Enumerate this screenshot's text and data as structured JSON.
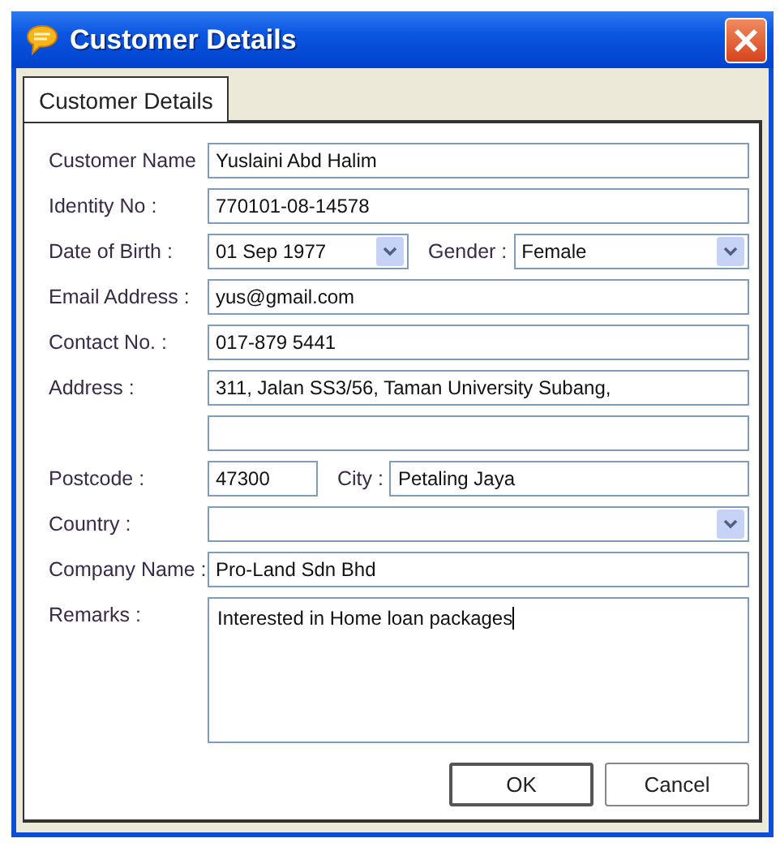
{
  "window": {
    "title": "Customer Details"
  },
  "tabs": [
    {
      "label": "Customer Details",
      "selected": true
    }
  ],
  "rows": [
    {
      "kind": "single",
      "label": "Customer Name",
      "inputs": [
        {
          "kind": "text",
          "value": "Yuslaini Abd Halim"
        }
      ]
    },
    {
      "kind": "single",
      "label": "Identity No :",
      "inputs": [
        {
          "kind": "text",
          "value": "770101-08-14578"
        }
      ]
    },
    {
      "kind": "pair",
      "label": "Date of Birth :",
      "inputs": [
        {
          "kind": "select",
          "value": "01 Sep 1977"
        },
        {
          "kind": "select",
          "label": "Gender :",
          "value": "Female"
        }
      ]
    },
    {
      "kind": "single",
      "label": "Email Address :",
      "inputs": [
        {
          "kind": "text",
          "value": "yus@gmail.com"
        }
      ]
    },
    {
      "kind": "single",
      "label": "Contact No. :",
      "inputs": [
        {
          "kind": "text",
          "value": "017-879 5441"
        }
      ]
    },
    {
      "kind": "single",
      "label": "Address :",
      "inputs": [
        {
          "kind": "text",
          "value": "311, Jalan SS3/56, Taman University Subang,"
        }
      ]
    },
    {
      "kind": "single",
      "inputs": [
        {
          "kind": "text"
        }
      ]
    },
    {
      "kind": "pair",
      "label": "Postcode :",
      "inputs": [
        {
          "kind": "text",
          "value": "47300"
        },
        {
          "kind": "text",
          "label": "City :",
          "value": "Petaling Jaya"
        }
      ]
    },
    {
      "kind": "single",
      "label": "Country :",
      "inputs": [
        {
          "kind": "select"
        }
      ]
    },
    {
      "kind": "single",
      "label": "Company Name :",
      "inputs": [
        {
          "kind": "text",
          "value": "Pro-Land Sdn Bhd"
        }
      ]
    },
    {
      "kind": "memo",
      "label": "Remarks :",
      "inputs": [
        {
          "kind": "textarea",
          "value": "Interested in Home loan packages"
        }
      ]
    }
  ],
  "buttons": [
    {
      "label": "OK",
      "default": true
    },
    {
      "label": "Cancel",
      "default": false
    }
  ]
}
